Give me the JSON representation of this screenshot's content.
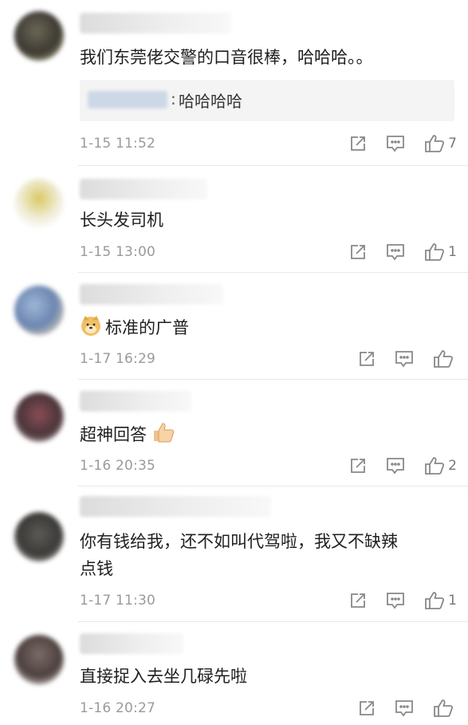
{
  "comments": [
    {
      "text": "我们东莞佬交警的口音很棒，哈哈哈。。",
      "reply_sep": ":",
      "reply_text": "哈哈哈哈",
      "time": "1-15 11:52",
      "likes": "7"
    },
    {
      "text": "长头发司机",
      "time": "1-15 13:00",
      "likes": "1"
    },
    {
      "text": "标准的广普",
      "time": "1-17 16:29",
      "likes": ""
    },
    {
      "text": "超神回答",
      "time": "1-16 20:35",
      "likes": "2"
    },
    {
      "text": "你有钱给我，还不如叫代驾啦，我又不缺辣\n点钱",
      "time": "1-17 11:30",
      "likes": "1"
    },
    {
      "text": "直接捉入去坐几碌先啦",
      "time": "1-16 20:27",
      "likes": ""
    }
  ],
  "icons": {
    "share": "share-icon",
    "reply": "comment-icon",
    "like": "thumbs-up-icon",
    "doge": "doge-emoji-icon",
    "thumb_emoji": "thumbs-up-emoji-icon"
  },
  "colors": {
    "meta_text": "#9a9a9a",
    "divider": "#e8e8e8",
    "reply_bg": "#f4f4f4",
    "icon": "#888888"
  }
}
